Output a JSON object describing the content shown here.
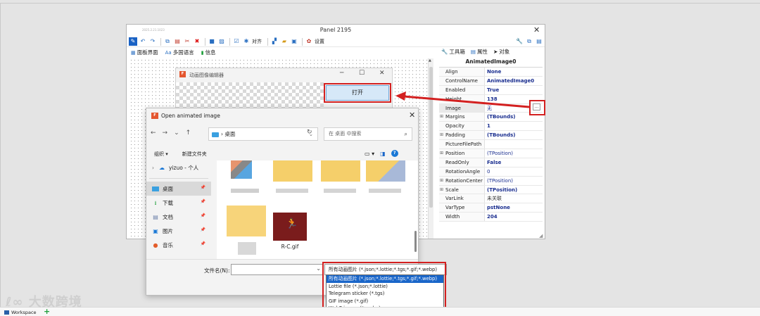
{
  "panel": {
    "version": "2025.2.21.1023",
    "title": "Panel 2195",
    "toolbar_align": "对齐",
    "toolbar_settings": "设置",
    "tabs": [
      "面板界面",
      "多国语言",
      "信息"
    ],
    "tab_icons": [
      "Aa"
    ]
  },
  "inspector": {
    "tabs": [
      "工具箱",
      "属性",
      "对象"
    ],
    "component": "AnimatedImage0",
    "props": [
      {
        "name": "Align",
        "value": "None"
      },
      {
        "name": "ControlName",
        "value": "AnimatedImage0"
      },
      {
        "name": "Enabled",
        "value": "True"
      },
      {
        "name": "Height",
        "value": "138"
      },
      {
        "name": "Image",
        "value": "无"
      },
      {
        "name": "Margins",
        "value": "(TBounds)"
      },
      {
        "name": "Opacity",
        "value": "1"
      },
      {
        "name": "Padding",
        "value": "(TBounds)"
      },
      {
        "name": "PictureFilePath",
        "value": ""
      },
      {
        "name": "Position",
        "value": "(TPosition)"
      },
      {
        "name": "ReadOnly",
        "value": "False"
      },
      {
        "name": "RotationAngle",
        "value": "0"
      },
      {
        "name": "RotationCenter",
        "value": "(TPosition)"
      },
      {
        "name": "Scale",
        "value": "(TPosition)"
      },
      {
        "name": "VarLink",
        "value": "未关联"
      },
      {
        "name": "VarType",
        "value": "pstNone"
      },
      {
        "name": "Width",
        "value": "204"
      }
    ],
    "dots": "..."
  },
  "editor": {
    "title": "动画图像编辑器",
    "open_button": "打开"
  },
  "dialog": {
    "title": "Open animated image",
    "address": "桌面",
    "search_placeholder": "在 桌面 中搜索",
    "organize": "组织 ▾",
    "new_folder": "新建文件夹",
    "nav_items": [
      {
        "label": "yizuo - 个人"
      },
      {
        "label": "桌面"
      },
      {
        "label": "下载"
      },
      {
        "label": "文档"
      },
      {
        "label": "图片"
      },
      {
        "label": "音乐"
      }
    ],
    "file_name_label": "文件名(N):",
    "file_gif": "R-C.gif",
    "filter_selected": "所有动画图片 (*.json;*.lottie;*.tgs;*.gif;*.webp)",
    "filter_options": [
      "所有动画图片 (*.json;*.lottie;*.tgs;*.gif;*.webp)",
      "Lottie file (*.json;*.lottie)",
      "Telegram sticker (*.tgs)",
      "GIF image (*.gif)",
      "WebP image (*.webp)"
    ]
  },
  "bottom": {
    "workspace": "Workspace",
    "watermark": "大数跨境"
  }
}
